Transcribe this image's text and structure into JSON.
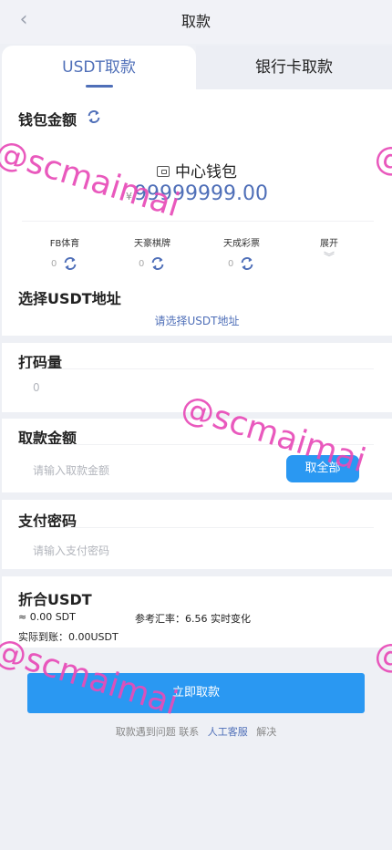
{
  "header": {
    "title": "取款",
    "back_icon": "chevron-left-icon"
  },
  "tabs": [
    {
      "label": "USDT取款",
      "active": true
    },
    {
      "label": "银行卡取款",
      "active": false
    }
  ],
  "wallet": {
    "section_title": "钱包金额",
    "center_label": "中心钱包",
    "currency_symbol": "¥",
    "balance": "99999999.00",
    "sub_wallets": [
      {
        "name": "FB体育",
        "value": "0"
      },
      {
        "name": "天豪棋牌",
        "value": "0"
      },
      {
        "name": "天成彩票",
        "value": "0"
      }
    ],
    "expand_label": "展开"
  },
  "usdt_address": {
    "section_title": "选择USDT地址",
    "link": "请选择USDT地址"
  },
  "bet": {
    "section_title": "打码量",
    "value": "0"
  },
  "amount": {
    "section_title": "取款金额",
    "placeholder": "请输入取款金额",
    "all_button": "取全部"
  },
  "password": {
    "section_title": "支付密码",
    "placeholder": "请输入支付密码"
  },
  "usdt_convert": {
    "section_title": "折合USDT",
    "approx": "≈ 0.00 SDT",
    "rate": "参考汇率：6.56 实时变化",
    "actual": "实际到账：0.00USDT"
  },
  "submit_label": "立即取款",
  "help": {
    "prefix": "取款遇到问题",
    "mid": "联系",
    "link": "人工客服",
    "suffix": "解决"
  },
  "watermark": "@scmaimai",
  "colors": {
    "accent": "#4f6fb8",
    "button": "#2a98f2",
    "watermark": "#e84bb8"
  }
}
